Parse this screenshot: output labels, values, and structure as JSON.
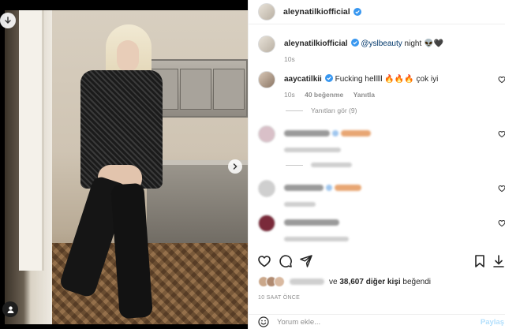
{
  "post": {
    "author": "aleynatilkiofficial",
    "caption_mention": "@yslbeauty",
    "caption_text": " night",
    "caption_emoji": "👽🖤",
    "caption_time": "10s"
  },
  "comments": [
    {
      "user": "aaycatilkii",
      "text": "Fucking helllll ",
      "emoji": "🔥🔥🔥",
      "text_after": " çok iyi",
      "time": "10s",
      "likes": "40 beğenme",
      "reply_label": "Yanıtla",
      "view_replies": "Yanıtları gör (9)"
    }
  ],
  "actions": {
    "like_icon": "heart-icon",
    "comment_icon": "comment-icon",
    "share_icon": "paper-plane-icon",
    "save_icon": "bookmark-icon"
  },
  "likes_summary": {
    "prefix": "ve",
    "count_text": "38,607 diğer kişi",
    "suffix": "beğendi"
  },
  "timestamp": "10 SAAT ÖNCE",
  "add_comment": {
    "placeholder": "Yorum ekle...",
    "post_label": "Paylaş"
  },
  "colors": {
    "verified": "#3897f0",
    "link": "#00376b",
    "muted": "#8e8e8e",
    "post_disabled": "#b2dffc"
  }
}
